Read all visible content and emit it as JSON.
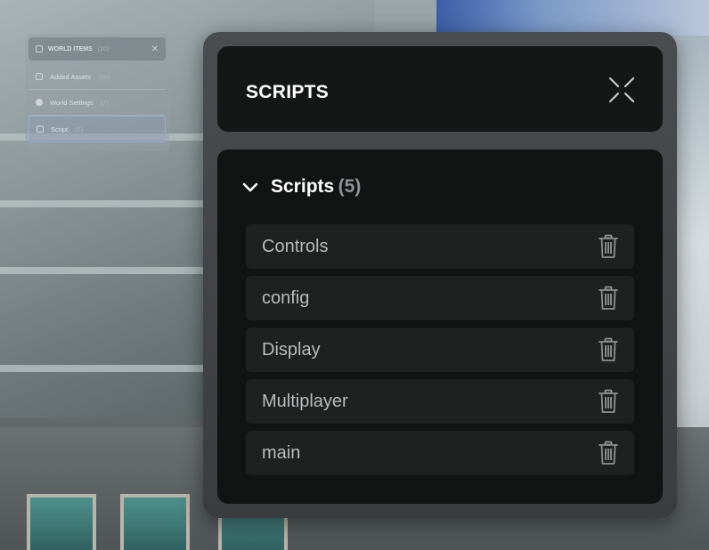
{
  "world_items_panel": {
    "title": "WORLD ITEMS",
    "title_count": "(10)",
    "rows": [
      {
        "label": "Added Assets",
        "count": "(98)",
        "icon": "plus-square-icon"
      },
      {
        "label": "World Settings",
        "count": "(7)",
        "icon": "globe-icon"
      },
      {
        "label": "Script",
        "count": "(5)",
        "icon": "script-icon",
        "selected": true
      }
    ]
  },
  "scripts_modal": {
    "title": "SCRIPTS",
    "section": {
      "label": "Scripts",
      "count": "(5)",
      "expanded": true
    },
    "items": [
      {
        "label": "Controls"
      },
      {
        "label": "config"
      },
      {
        "label": "Display"
      },
      {
        "label": "Multiplayer"
      },
      {
        "label": "main"
      }
    ]
  },
  "colors": {
    "modal_bg": "#3a3c3e",
    "panel_bg": "#151616",
    "row_bg": "#1f2020",
    "text_primary": "#ffffff",
    "text_secondary": "#b9bbbc",
    "count_gray": "#8e9294"
  }
}
